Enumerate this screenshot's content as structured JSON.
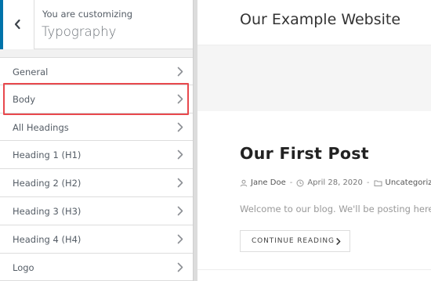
{
  "customizer": {
    "back_label": "Back",
    "header_sub": "You are customizing",
    "header_title": "Typography",
    "items": [
      {
        "label": "General"
      },
      {
        "label": "Body"
      },
      {
        "label": "All Headings"
      },
      {
        "label": "Heading 1 (H1)"
      },
      {
        "label": "Heading 2 (H2)"
      },
      {
        "label": "Heading 3 (H3)"
      },
      {
        "label": "Heading 4 (H4)"
      },
      {
        "label": "Logo"
      }
    ],
    "highlighted_item": "Body",
    "accent_color": "#0073aa",
    "highlight_color": "#e8484d"
  },
  "preview": {
    "site_title": "Our Example Website",
    "post": {
      "title": "Our First Post",
      "author": "Jane Doe",
      "date": "April 28, 2020",
      "category": "Uncategorized",
      "excerpt": "Welcome to our blog. We'll be posting here w",
      "continue_label": "CONTINUE READING"
    }
  }
}
